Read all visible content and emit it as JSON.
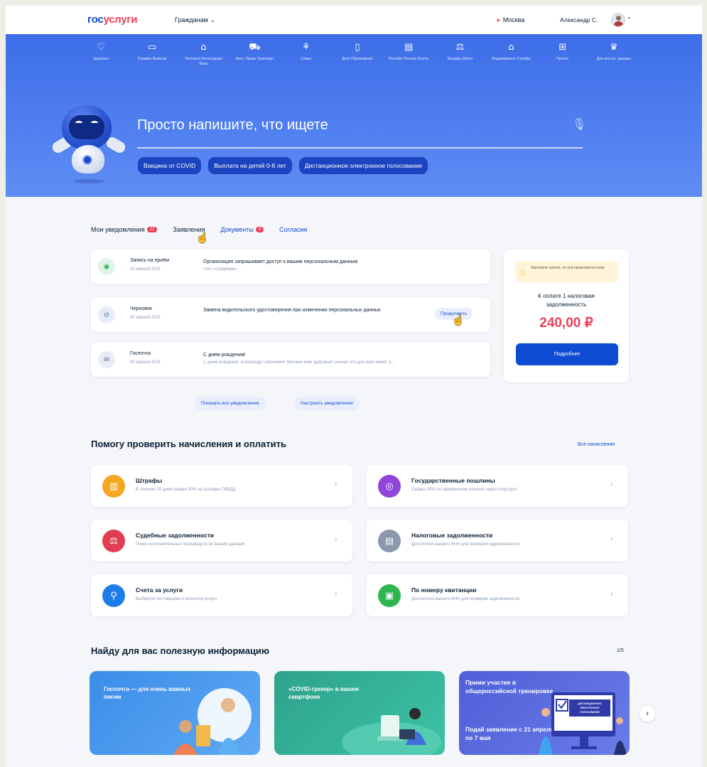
{
  "header": {
    "logo_part1": "гос",
    "logo_part2": "услуги",
    "audience": "Гражданам ⌄",
    "city": "Москва",
    "user": "Александр С.",
    "user_chevron": "⌃"
  },
  "categories": [
    {
      "icon": "♡",
      "label": "Здоровье"
    },
    {
      "icon": "▭",
      "label": "Справки Выписки"
    },
    {
      "icon": "⌂",
      "label": "Паспорта Регистрации Визы"
    },
    {
      "icon": "⛟",
      "label": "Авто. Права Транспорт"
    },
    {
      "icon": "⚘",
      "label": "Семья"
    },
    {
      "icon": "▯",
      "label": "Дети Образование"
    },
    {
      "icon": "▤",
      "label": "Пособия Пенсии Льготы"
    },
    {
      "icon": "⚖",
      "label": "Штрафы Долги"
    },
    {
      "icon": "⌂",
      "label": "Недвижимость Стройка"
    },
    {
      "icon": "⊞",
      "label": "Прочее"
    },
    {
      "icon": "♛",
      "label": "Для иностр. граждан"
    }
  ],
  "search": {
    "placeholder": "Просто напишите, что ищете",
    "chips": [
      "Вакцина от COVID",
      "Выплата на детей 0-8 лет",
      "Дистанционное электронное голосование"
    ]
  },
  "tabs": [
    {
      "label": "Мои уведомления",
      "badge": "12"
    },
    {
      "label": "Заявления",
      "badge": ""
    },
    {
      "label": "Документы",
      "badge": "4"
    },
    {
      "label": "Согласия",
      "badge": ""
    }
  ],
  "notifications": [
    {
      "category": "Запись на приём",
      "date": "15 апреля 2021",
      "title": "Организация запрашивает доступ к вашим персональным данным",
      "subtitle": "ПАО «Сбербанк»",
      "action": ""
    },
    {
      "category": "Черновик",
      "date": "30 апреля 2021",
      "title": "Замена водительского удостоверения при изменении персональных данных",
      "subtitle": "",
      "action": "Продолжить"
    },
    {
      "category": "Госпочта",
      "date": "30 апреля 2021",
      "title": "С днем рождения!",
      "subtitle": "С днем рождения, Александр Сергеевич! Желаем Вам здоровья! Сейчас это для всех имеет о...",
      "action": ""
    }
  ],
  "notification_buttons": [
    "Показать все уведомления",
    "Настроить уведомления"
  ],
  "tax": {
    "warning": "Заплатите налоги, не они начисляются пени",
    "label": "К оплате 1 налоговая задолженность",
    "amount": "240,00 ₽",
    "button": "Подробнее"
  },
  "payments": {
    "title": "Помогу проверить начисления и оплатить",
    "all_link": "Все начисления",
    "items": [
      {
        "title": "Штрафы",
        "subtitle": "В течение 20 дней скидка 50% на штрафы ГИБДД",
        "color": "#f5a623",
        "icon": "▥"
      },
      {
        "title": "Государственные пошлины",
        "subtitle": "Скидка 30% на оформление пошлин через госуслуги",
        "color": "#8f45d9",
        "icon": "◎"
      },
      {
        "title": "Судебные задолженности",
        "subtitle": "Поиск исполнительных производств по вашим данным",
        "color": "#e23d52",
        "icon": "⚖"
      },
      {
        "title": "Налоговые задолженности",
        "subtitle": "Достаточно вашего ИНН для проверки задолженности",
        "color": "#8b97ad",
        "icon": "▤"
      },
      {
        "title": "Счета за услуги",
        "subtitle": "Выберите поставщика и оплатите услуги",
        "color": "#1e7ce8",
        "icon": "⚲"
      },
      {
        "title": "По номеру квитанции",
        "subtitle": "Достаточно вашего ИНН для проверки задолженности",
        "color": "#2eb54f",
        "icon": "▣"
      }
    ]
  },
  "info": {
    "title": "Найду для вас полезную информацию",
    "pager": "1/5",
    "cards": [
      {
        "title": "Госпочта — для очень важных писем"
      },
      {
        "title": "«COVID-трекер» в вашем смартфоне"
      },
      {
        "title": "Прими участие в общероссийской тренировке",
        "title2": "Подай заявление с 21 апреля по 7 мая",
        "sign": "ДИСТАНЦИОННОЕ ЭЛЕКТРОННОЕ ГОЛОСОВАНИЕ"
      }
    ]
  }
}
